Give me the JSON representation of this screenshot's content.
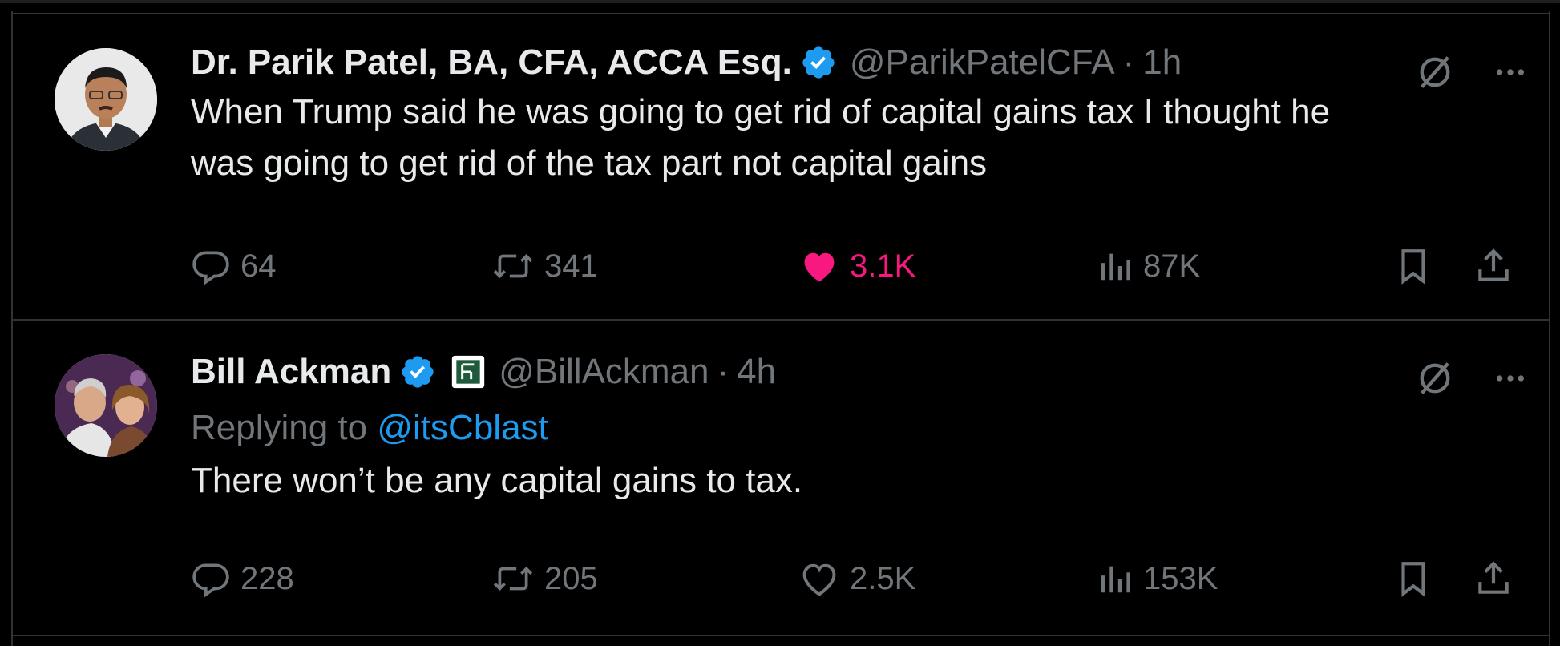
{
  "tweets": [
    {
      "author": "Dr. Parik Patel, BA, CFA, ACCA Esq.",
      "handle": "@ParikPatelCFA",
      "separator": "·",
      "time": "1h",
      "text_lines": [
        "When Trump said he was going to get rid of capital gains tax I thought he",
        "was going to get rid of the tax part not capital gains"
      ],
      "replies": "64",
      "retweets": "341",
      "likes": "3.1K",
      "liked": true,
      "views": "87K"
    },
    {
      "author": "Bill Ackman",
      "handle": "@BillAckman",
      "separator": "·",
      "time": "4h",
      "replying_to_label": "Replying to",
      "replying_to_handle": "@itsCblast",
      "text_lines": [
        "There won’t be any capital gains to tax."
      ],
      "replies": "228",
      "retweets": "205",
      "likes": "2.5K",
      "liked": false,
      "views": "153K"
    }
  ],
  "colors": {
    "background": "#000000",
    "text": "#e7e9ea",
    "muted": "#71767b",
    "verified": "#1d9bf0",
    "like": "#f91880",
    "border": "#2f3336"
  },
  "icons": [
    "verified-badge-icon",
    "affiliate-badge-icon",
    "grok-icon",
    "more-icon",
    "reply-icon",
    "retweet-icon",
    "heart-icon",
    "views-icon",
    "bookmark-icon",
    "share-icon"
  ]
}
